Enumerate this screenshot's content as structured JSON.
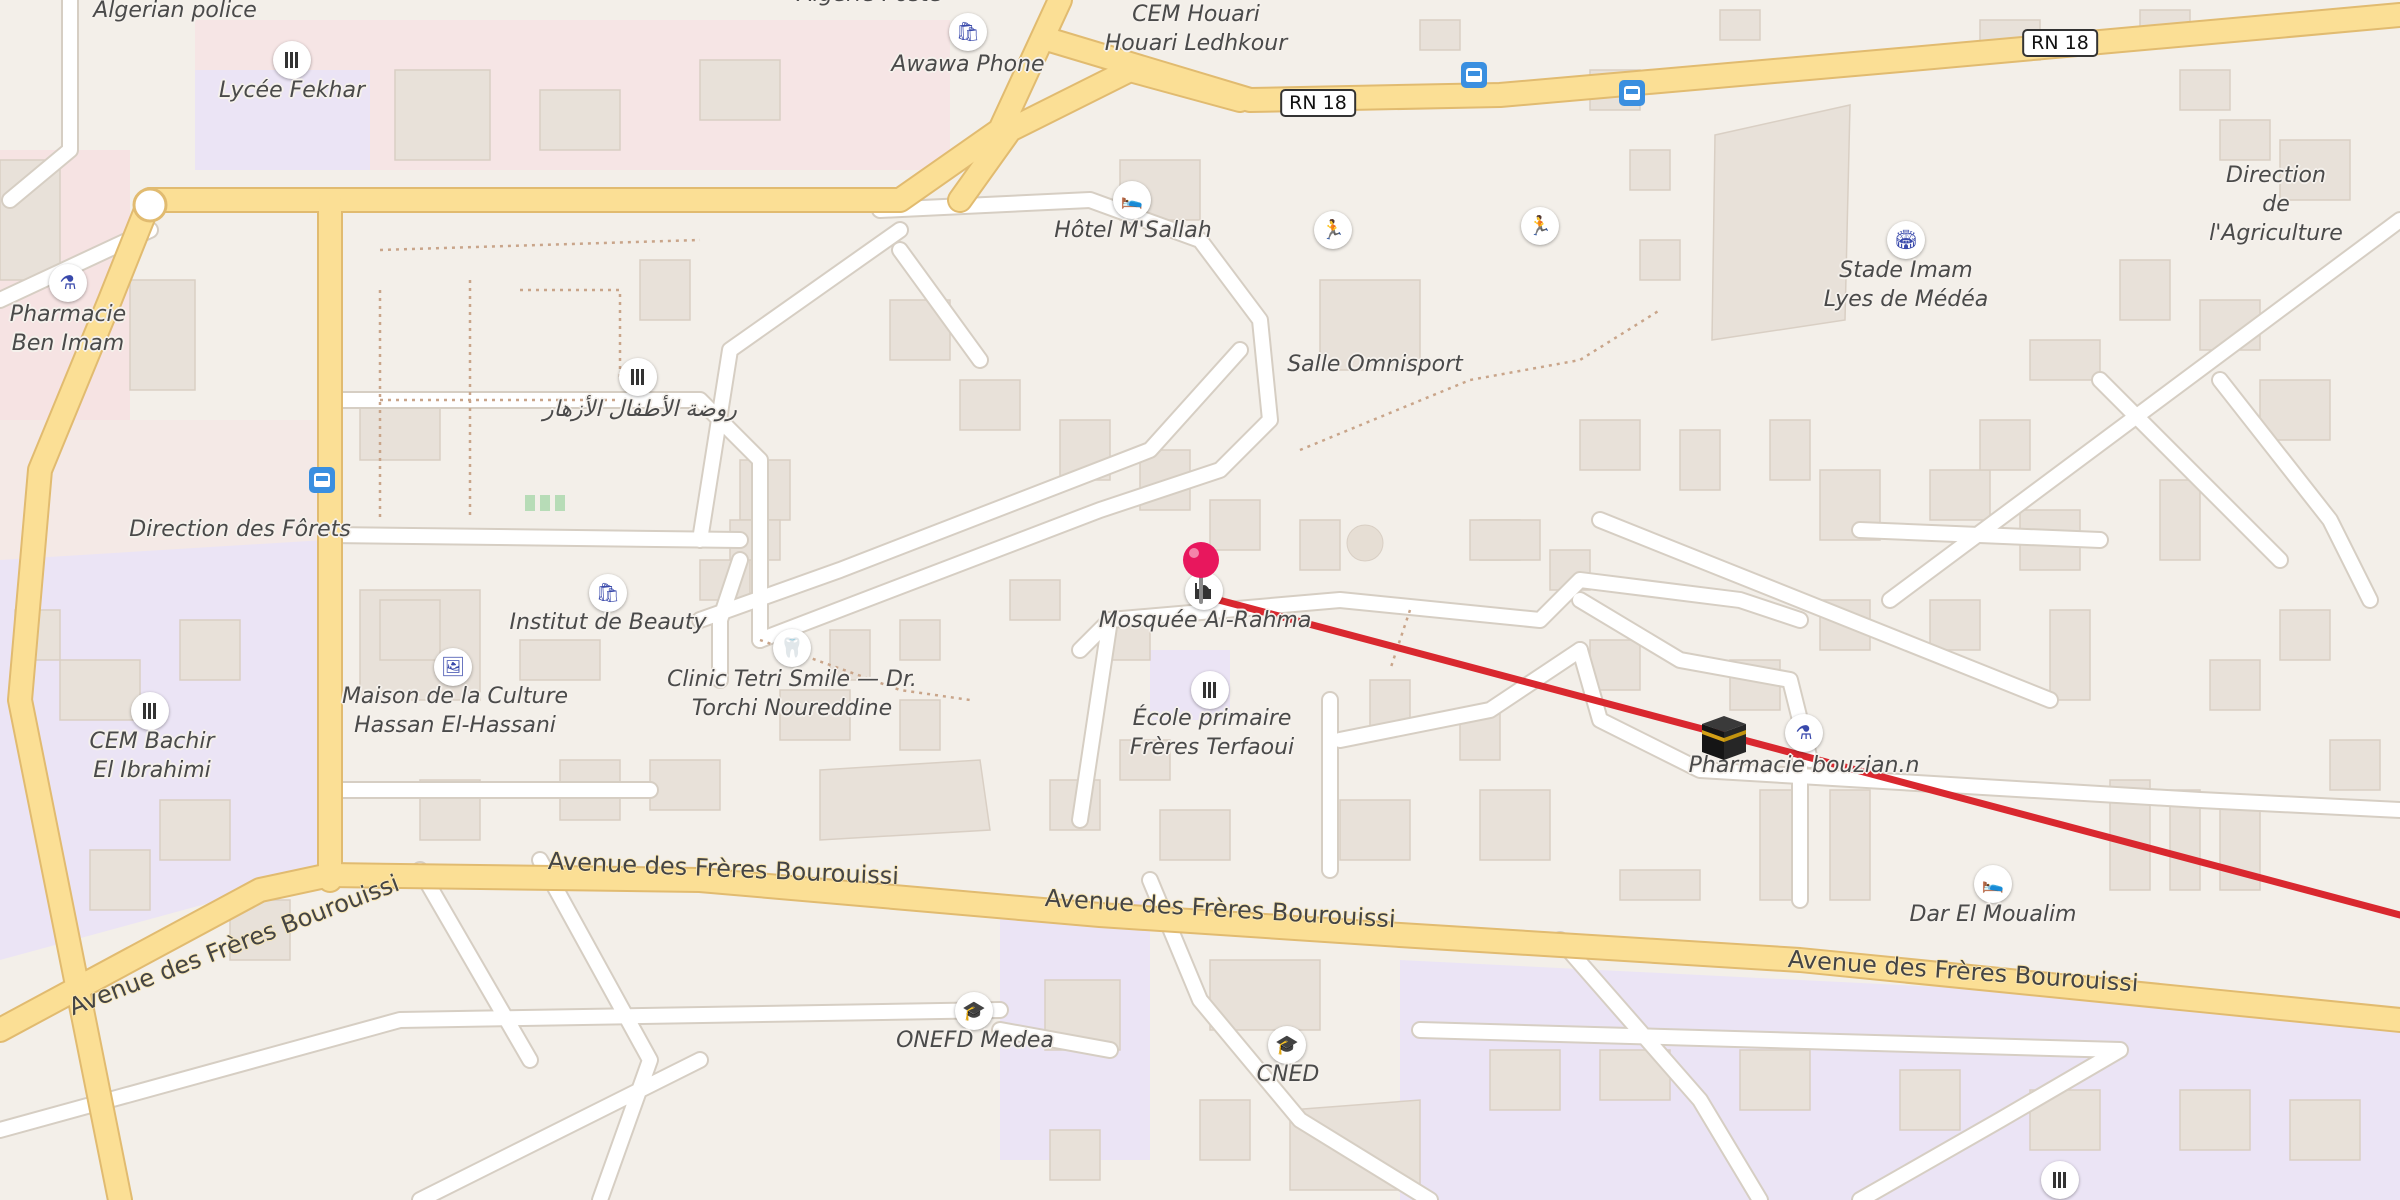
{
  "map": {
    "colors": {
      "land": "#f3efe9",
      "road_major": "#fbdf95",
      "road_major_casing": "#e3bd73",
      "road_minor": "#ffffff",
      "road_minor_casing": "#d8d1c7",
      "building": "#e8e1d9",
      "building_edge": "#d9d0c5",
      "education": "#ebe4f5",
      "health": "#f7e4e4",
      "route": "#d9282f",
      "pin": "#e8175d"
    },
    "labels": {
      "algerian_police": "Algerian police",
      "algerie_poste": "Algérie Poste",
      "cem_houari": "CEM Houari\nHouari Ledhkour",
      "awawa_phone": "Awawa Phone",
      "lycee_fekhar": "Lycée Fekhar",
      "hotel_msallah": "Hôtel M'Sallah",
      "pharmacie_ben_imam": "Pharmacie\nBen Imam",
      "salle_omnisport": "Salle Omnisport",
      "stade_imam": "Stade Imam\nLyes de Médéa",
      "direction_agriculture": "Direction de\nl'Agriculture",
      "rawdat": "روضة الأطفال الأزهار",
      "direction_forets": "Direction des Fôrets",
      "institut_beauty": "Institut de Beauty",
      "mosquee": "Mosquée Al-Rahma",
      "maison_culture": "Maison de la Culture\nHassan El-Hassani",
      "clinic": "Clinic Tetri Smile — Dr.\nTorchi Noureddine",
      "ecole_primaire": "École primaire\nFrères Terfaoui",
      "pharmacie_bouzian": "Pharmacie bouzian.n",
      "cem_bachir": "CEM Bachir\nEl Ibrahimi",
      "dar_el_moualim": "Dar El Moualim",
      "onefd": "ONEFD Medea",
      "cned": "CNED"
    },
    "roads": {
      "avenue": "Avenue des Frères Bourouissi",
      "rn18": "RN 18"
    },
    "icons": {
      "shop": "shopping-bag-icon",
      "school": "school-icon",
      "hotel": "bed-icon",
      "pharmacy": "pharmacy-icon",
      "stadium": "stadium-icon",
      "sport": "running-person-icon",
      "bus": "bus-stop-icon",
      "dentist": "tooth-icon",
      "culture": "picture-icon",
      "mosque": "mosque-icon",
      "graduation": "graduation-cap-icon",
      "kaaba": "kaaba-icon",
      "pin": "location-pin-icon"
    }
  }
}
